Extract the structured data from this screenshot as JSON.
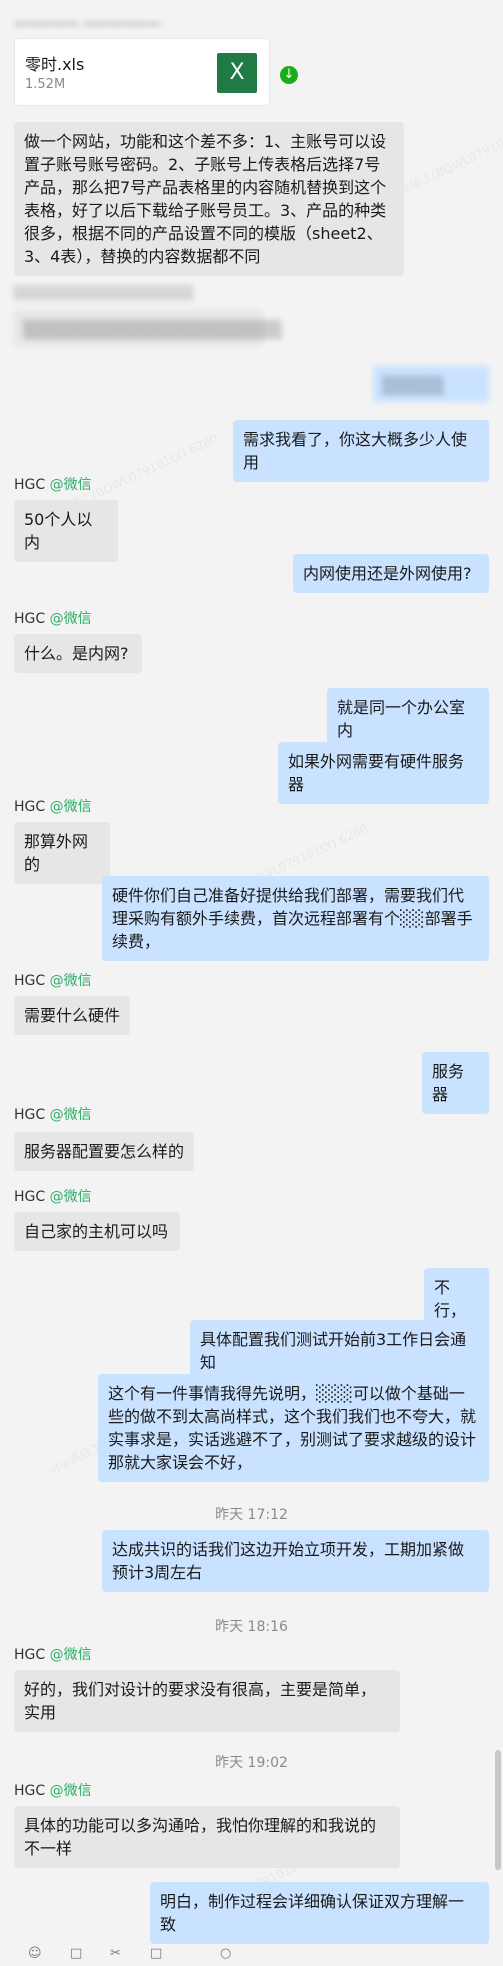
{
  "top_blurred": "一一一一一 一一一一一一",
  "file": {
    "name": "零时.xls",
    "size": "1.52M",
    "icon_letter": "X"
  },
  "messages": {
    "m1": "做一个网站，功能和这个差不多：1、主账号可以设置子账号账号密码。2、子账号上传表格后选择7号产品，那么把7号产品表格里的内容随机替换到这个表格，好了以后下载给子账号员工。3、产品的种类很多，根据不同的产品设置不同的模版（sheet2、3、4表），替换的内容数据都不同",
    "m2": "需求我看了，你这大概多少人使用",
    "m3": "50个人以内",
    "m4": "内网使用还是外网使用?",
    "m5": "什么。是内网?",
    "m6": "就是同一个办公室内",
    "m7": "如果外网需要有硬件服务器",
    "m8": "那算外网的",
    "m9": "硬件你们自己准备好提供给我们部署，需要我们代理采购有额外手续费，首次远程部署有个░░部署手续费，",
    "m10": "需要什么硬件",
    "m11": "服务器",
    "m12": "服务器配置要怎么样的",
    "m13": "自己家的主机可以吗",
    "m14": "不行，",
    "m15": "具体配置我们测试开始前3工作日会通知",
    "m16": "这个有一件事情我得先说明，░░░可以做个基础一些的做不到太高尚样式，这个我们我们也不夸大，就实事求是，实话逃避不了，别测试了要求越级的设计那就大家误会不好，",
    "m17": "达成共识的话我们这边开始立项开发，工期加紧做预计3周左右",
    "m18": "好的，我们对设计的要求没有很高，主要是简单，实用",
    "m19": "具体的功能可以多沟通哈，我怕你理解的和我说的不一样",
    "m20": "明白，制作过程会详细确认保证双方理解一致",
    "blur_right": "░░░░░",
    "blur_left1": "░░░░░░░░░░░░░░░░░░",
    "blur_left2": "░░░░░░░░░░░░░░░░░░░░░"
  },
  "sender": {
    "name": "HGC",
    "source": "@微信"
  },
  "times": {
    "t1": "昨天 17:12",
    "t2": "昨天 18:16",
    "t3": "昨天 19:02"
  },
  "watermark_text": "vba高级工(BQWL079101LY) 6280",
  "colors": {
    "left_bubble": "#e6e6e6",
    "right_bubble": "#c9e2ff",
    "source_green": "#2aae67",
    "excel_green": "#1f7a45"
  }
}
